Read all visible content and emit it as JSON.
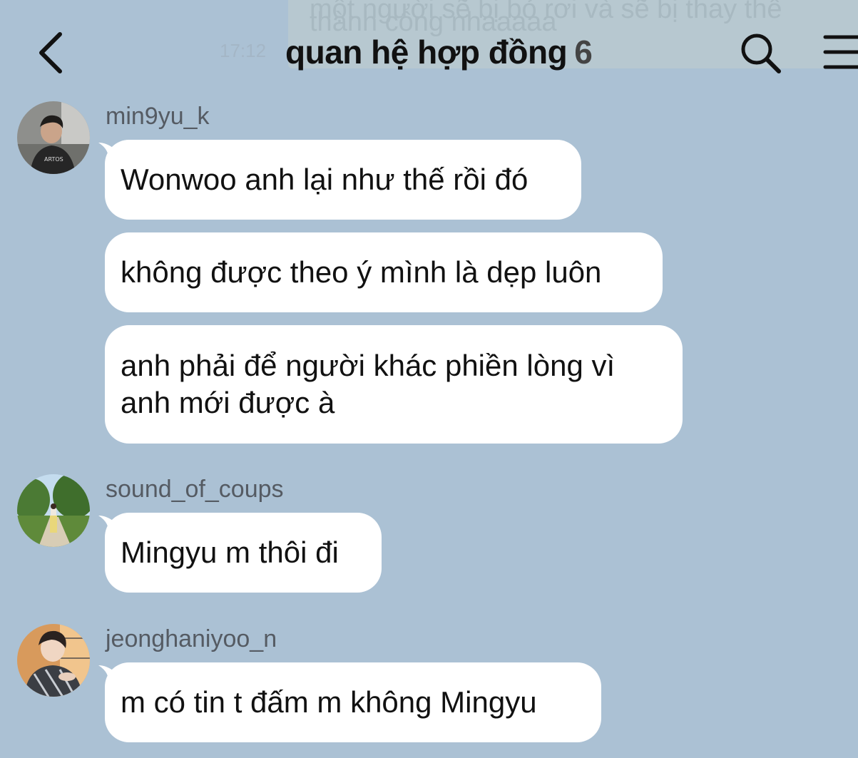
{
  "header": {
    "title": "quan hệ hợp đồng",
    "member_count": "6",
    "back_icon": "chevron-left-icon",
    "search_icon": "search-icon",
    "menu_icon": "menu-icon",
    "background_line1": "một người sẽ bị bỏ rơi và sẽ bị thay thế",
    "background_line2": "thành công nhaaaaa",
    "background_time": "17:12"
  },
  "colors": {
    "background": "#abc1d4",
    "bubble": "#ffffff",
    "sender_text": "#555b63"
  },
  "messages": [
    {
      "sender": "min9yu_k",
      "bubbles": [
        "Wonwoo anh lại như thế rồi đó",
        "không được theo ý mình là dẹp luôn",
        "anh phải để người khác phiền lòng vì anh mới được à"
      ]
    },
    {
      "sender": "sound_of_coups",
      "bubbles": [
        "Mingyu m thôi đi"
      ]
    },
    {
      "sender": "jeonghaniyoo_n",
      "bubbles": [
        "m có tin t đấm m không Mingyu"
      ]
    }
  ]
}
